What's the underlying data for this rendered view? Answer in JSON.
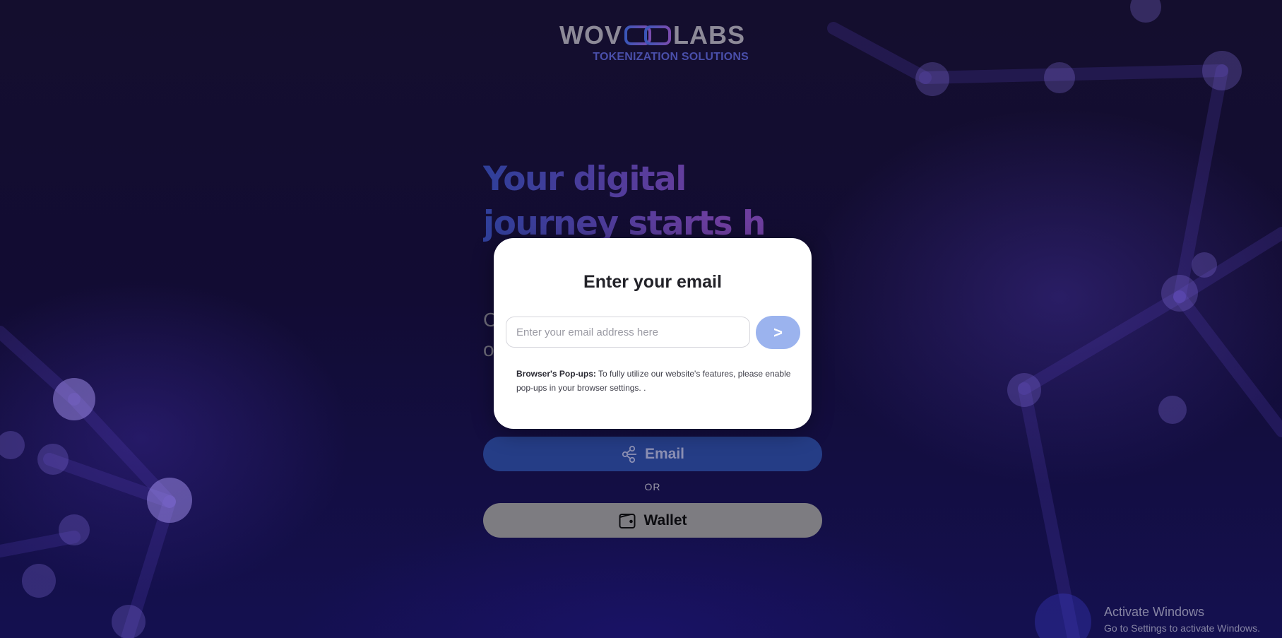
{
  "brand": {
    "logo_left": "WOV",
    "logo_right": "LABS",
    "tagline": "TOKENIZATION SOLUTIONS"
  },
  "hero": {
    "title": "Your digital journey starts h",
    "subtitle": "C\no"
  },
  "modal": {
    "title": "Enter your email",
    "email_placeholder": "Enter your email address here",
    "email_value": "",
    "submit_label": ">",
    "popup_note_label": "Browser's Pop-ups:",
    "popup_note_text": "To fully utilize our website's features, please enable pop-ups in your browser settings. ."
  },
  "auth": {
    "email_button_label": "Email",
    "or_label": "OR",
    "wallet_button_label": "Wallet"
  },
  "watermark": {
    "title": "Activate Windows",
    "subtitle": "Go to Settings to activate Windows."
  },
  "icons": {
    "email_button_icon": "nodes-icon",
    "wallet_button_icon": "wallet-icon",
    "logo_mark": "chain-link-icon"
  },
  "colors": {
    "background": "#120c33",
    "email_button": "#253d86",
    "wallet_button": "#7d7c81",
    "submit_button": "#9bb3ee",
    "modal": "#ffffff"
  }
}
